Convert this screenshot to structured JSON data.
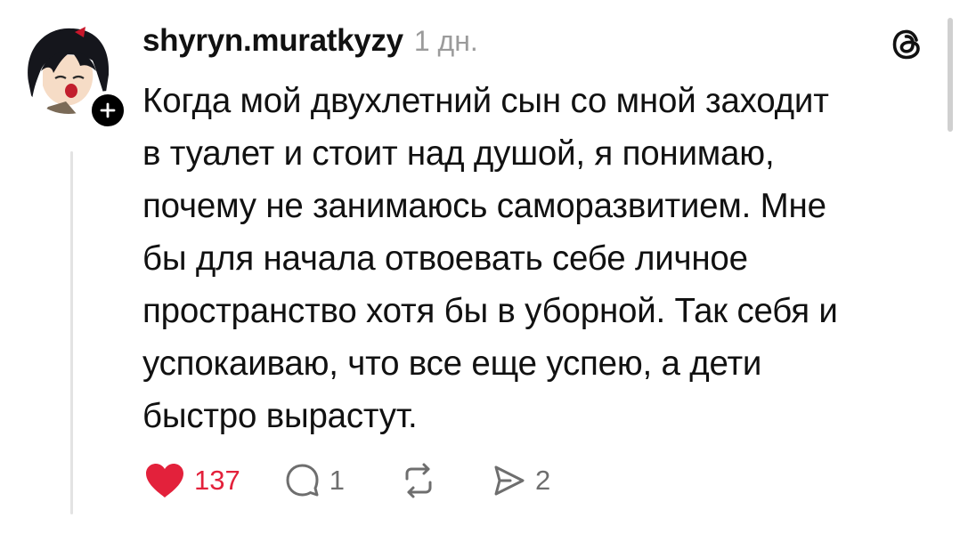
{
  "post": {
    "username": "shyryn.muratkyzy",
    "timestamp": "1 дн.",
    "lines": [
      "Когда мой двухлетний сын со мной заходит",
      "в туалет и стоит над душой, я понимаю,",
      "почему не занимаюсь саморазвитием. Мне",
      "бы для начала отвоевать себе личное",
      "пространство хотя бы в уборной. Так себя и",
      "успокаиваю, что все еще успею, а дети",
      "быстро вырастут."
    ]
  },
  "actions": {
    "likes": "137",
    "replies": "1",
    "shares": "2"
  },
  "colors": {
    "like": "#e3213b",
    "muted": "#6e6e6e",
    "timestamp": "#9b9b9b",
    "text": "#111111"
  },
  "icons": {
    "like": "heart-icon",
    "reply": "comment-bubble-icon",
    "repost": "repost-icon",
    "share": "send-icon",
    "brand": "threads-logo-icon",
    "follow": "plus-icon"
  }
}
